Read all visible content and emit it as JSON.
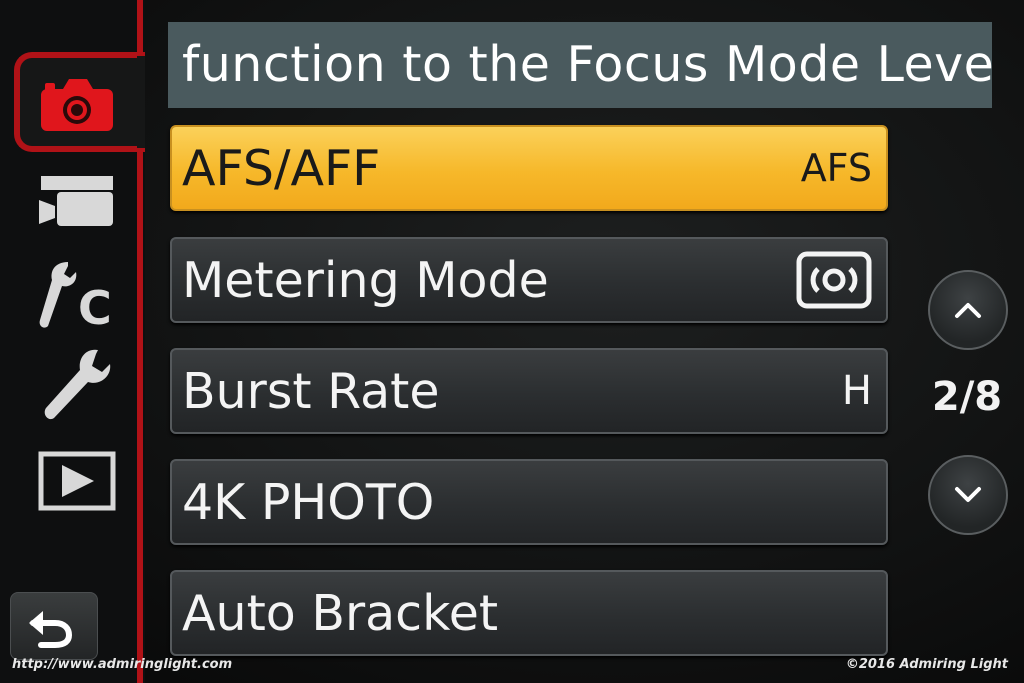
{
  "header": {
    "text": "function to the Focus Mode Leve"
  },
  "rail": {
    "tabs": [
      {
        "icon": "camera-icon",
        "active": true
      },
      {
        "icon": "video-camera-icon",
        "active": false
      },
      {
        "icon": "custom-fc-icon",
        "label": "C",
        "active": false
      },
      {
        "icon": "wrench-icon",
        "active": false
      },
      {
        "icon": "play-icon",
        "active": false
      }
    ],
    "back_icon": "return-arrow-icon"
  },
  "menu": {
    "items": [
      {
        "label": "AFS/AFF",
        "value": "AFS",
        "selected": true
      },
      {
        "label": "Metering Mode",
        "value_icon": "metering-multi-icon",
        "selected": false
      },
      {
        "label": "Burst Rate",
        "value": "H",
        "selected": false
      },
      {
        "label": "4K PHOTO",
        "value": "",
        "selected": false
      },
      {
        "label": "Auto Bracket",
        "value": "",
        "selected": false
      }
    ]
  },
  "pagination": {
    "current": "2/8",
    "up_icon": "chevron-up-icon",
    "down_icon": "chevron-down-icon"
  },
  "watermark": {
    "left": "http://www.admiringlight.com",
    "right": "©2016 Admiring Light"
  },
  "colors": {
    "accent_red": "#b01217",
    "selected_yellow": "#f6b82a",
    "header_bg": "#4a5a5e"
  }
}
